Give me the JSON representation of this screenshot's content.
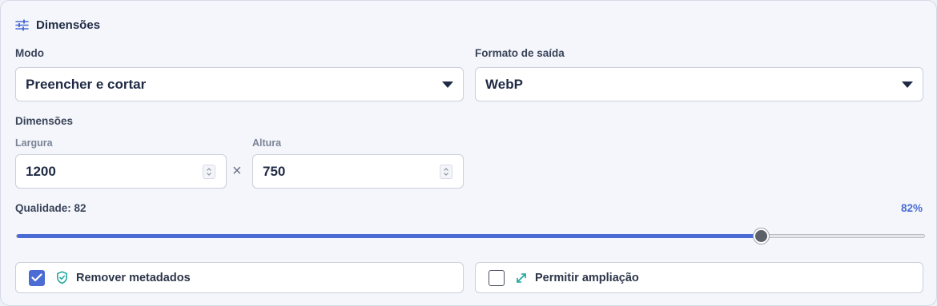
{
  "section": {
    "title": "Dimensões",
    "icon": "sliders-icon"
  },
  "mode": {
    "label": "Modo",
    "value": "Preencher e cortar"
  },
  "format": {
    "label": "Formato de saída",
    "value": "WebP"
  },
  "dimensions": {
    "label": "Dimensões",
    "width_label": "Largura",
    "width_value": "1200",
    "separator": "×",
    "height_label": "Altura",
    "height_value": "750"
  },
  "quality": {
    "label": "Qualidade: 82",
    "percent_text": "82%",
    "value": 82,
    "min": 0,
    "max": 100
  },
  "options": {
    "strip_metadata": {
      "label": "Remover metadados",
      "checked": true,
      "icon": "shield-check-icon"
    },
    "allow_upscale": {
      "label": "Permitir ampliação",
      "checked": false,
      "icon": "expand-arrows-icon"
    }
  },
  "colors": {
    "accent": "#4a6cd4",
    "text": "#1f2a44",
    "shield": "#1aa39a"
  }
}
